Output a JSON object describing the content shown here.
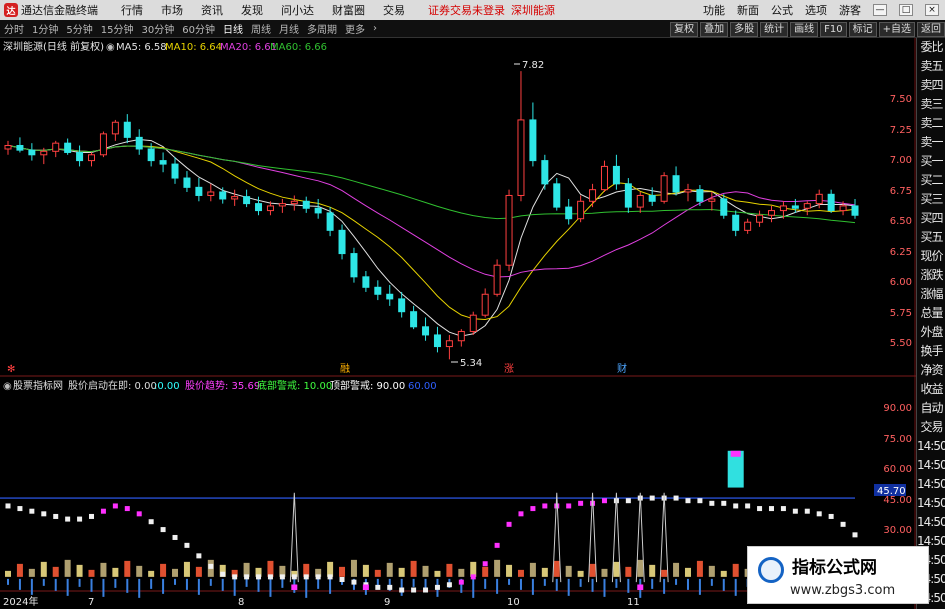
{
  "app_title": "通达信金融终端",
  "menu": [
    "行情",
    "市场",
    "资讯",
    "发现",
    "问小达",
    "财富圈",
    "交易"
  ],
  "warn_text": "证券交易未登录",
  "stock_link": "深圳能源",
  "right_menu": [
    "功能",
    "新面",
    "公式",
    "选项"
  ],
  "right_user": "游客",
  "win_buttons": [
    "—",
    "□",
    "×"
  ],
  "colors": {
    "up": "#ff4040",
    "down": "#2ee6e6",
    "ma5": "#e0e0e0",
    "ma10": "#e6d200",
    "ma20": "#e040e0",
    "ma60": "#30c030",
    "magenta": "#ff30ff",
    "yellow": "#ffff30",
    "blue_line": "#3060ff"
  },
  "period_tabs": [
    "分时",
    "1分钟",
    "5分钟",
    "15分钟",
    "30分钟",
    "60分钟",
    "日线",
    "周线",
    "月线",
    "多周期",
    "更多"
  ],
  "active_tab": "日线",
  "right_tools": [
    "复权",
    "叠加",
    "多股",
    "统计",
    "画线",
    "F10",
    "标记",
    "+自选",
    "返回"
  ],
  "main_header": {
    "title": "深圳能源(日线 前复权)",
    "ma": [
      {
        "label": "MA5: 6.58",
        "color": "#e0e0e0"
      },
      {
        "label": "MA10: 6.64",
        "color": "#e6d200"
      },
      {
        "label": "MA20: 6.61",
        "color": "#e040e0"
      },
      {
        "label": "MA60: 6.66",
        "color": "#30c030"
      }
    ]
  },
  "price_axis": [
    "7.50",
    "7.25",
    "7.00",
    "6.75",
    "6.50",
    "6.25",
    "6.00",
    "5.75",
    "5.50"
  ],
  "price_range": [
    5.3,
    7.95
  ],
  "high_label": "7.82",
  "low_label": "5.34",
  "event_marks": [
    {
      "label": "✻",
      "color": "#ff4040"
    },
    {
      "label": "融",
      "color": "#ffb000"
    },
    {
      "label": "涨",
      "color": "#ff4040"
    },
    {
      "label": "财",
      "color": "#4da6ff"
    }
  ],
  "sub_header": {
    "title": "股票指标网",
    "items": [
      {
        "label": "股价启动在即: 0.00",
        "color": "#dddddd"
      },
      {
        "label": ":0.00",
        "color": "#30ffff"
      },
      {
        "label": "股价趋势: 35.69",
        "color": "#ff40ff"
      },
      {
        "label": "底部警戒: 10.00",
        "color": "#40ff40"
      },
      {
        "label": "顶部警戒: 90.00",
        "color": "#ffffff"
      },
      {
        "label": "60.00",
        "color": "#3060ff"
      }
    ]
  },
  "sub_axis": [
    "90.00",
    "75.00",
    "60.00",
    "45.00",
    "30.00"
  ],
  "sub_current": "45.70",
  "date_axis": [
    "2024年",
    "7",
    "8",
    "9",
    "10",
    "11"
  ],
  "side_panel": [
    "委比",
    "卖五",
    "卖四",
    "卖三",
    "卖二",
    "卖一",
    "买一",
    "买二",
    "买三",
    "买四",
    "买五",
    "现价",
    "涨跌",
    "涨幅",
    "总量",
    "外盘",
    "换手",
    "净资",
    "收益",
    "自动",
    "交易",
    "14:50",
    "14:50",
    "14:50",
    "14:50",
    "14:50",
    "14:50",
    "14:50",
    "14:50",
    "14:50"
  ],
  "watermark": {
    "line1": "指标公式网",
    "line2": "www.zbgs3.com"
  },
  "chart_data": {
    "type": "candlestick",
    "series_name": "深圳能源",
    "ohlc": [
      [
        7.15,
        7.22,
        7.1,
        7.18
      ],
      [
        7.18,
        7.25,
        7.12,
        7.14
      ],
      [
        7.14,
        7.2,
        7.05,
        7.1
      ],
      [
        7.1,
        7.16,
        7.02,
        7.13
      ],
      [
        7.13,
        7.22,
        7.08,
        7.2
      ],
      [
        7.2,
        7.24,
        7.1,
        7.12
      ],
      [
        7.12,
        7.18,
        7.0,
        7.05
      ],
      [
        7.05,
        7.12,
        7.0,
        7.1
      ],
      [
        7.1,
        7.3,
        7.08,
        7.28
      ],
      [
        7.28,
        7.4,
        7.22,
        7.38
      ],
      [
        7.38,
        7.45,
        7.2,
        7.25
      ],
      [
        7.25,
        7.32,
        7.1,
        7.15
      ],
      [
        7.15,
        7.2,
        7.0,
        7.05
      ],
      [
        7.05,
        7.12,
        6.95,
        7.02
      ],
      [
        7.02,
        7.08,
        6.85,
        6.9
      ],
      [
        6.9,
        6.96,
        6.78,
        6.82
      ],
      [
        6.82,
        6.9,
        6.7,
        6.75
      ],
      [
        6.75,
        6.85,
        6.7,
        6.78
      ],
      [
        6.78,
        6.82,
        6.68,
        6.72
      ],
      [
        6.72,
        6.8,
        6.66,
        6.74
      ],
      [
        6.74,
        6.8,
        6.65,
        6.68
      ],
      [
        6.68,
        6.74,
        6.58,
        6.62
      ],
      [
        6.62,
        6.7,
        6.58,
        6.66
      ],
      [
        6.66,
        6.72,
        6.6,
        6.68
      ],
      [
        6.68,
        6.75,
        6.62,
        6.7
      ],
      [
        6.7,
        6.74,
        6.6,
        6.64
      ],
      [
        6.64,
        6.72,
        6.55,
        6.6
      ],
      [
        6.6,
        6.65,
        6.4,
        6.45
      ],
      [
        6.45,
        6.5,
        6.2,
        6.25
      ],
      [
        6.25,
        6.3,
        6.0,
        6.05
      ],
      [
        6.05,
        6.1,
        5.92,
        5.96
      ],
      [
        5.96,
        6.02,
        5.85,
        5.9
      ],
      [
        5.9,
        5.98,
        5.8,
        5.86
      ],
      [
        5.86,
        5.92,
        5.7,
        5.75
      ],
      [
        5.75,
        5.8,
        5.6,
        5.62
      ],
      [
        5.62,
        5.7,
        5.5,
        5.55
      ],
      [
        5.55,
        5.62,
        5.4,
        5.45
      ],
      [
        5.45,
        5.55,
        5.34,
        5.5
      ],
      [
        5.5,
        5.6,
        5.45,
        5.58
      ],
      [
        5.58,
        5.75,
        5.55,
        5.72
      ],
      [
        5.72,
        5.95,
        5.7,
        5.9
      ],
      [
        5.9,
        6.2,
        5.88,
        6.15
      ],
      [
        6.15,
        6.8,
        6.1,
        6.75
      ],
      [
        6.75,
        7.82,
        6.7,
        7.4
      ],
      [
        7.4,
        7.55,
        7.0,
        7.05
      ],
      [
        7.05,
        7.1,
        6.8,
        6.85
      ],
      [
        6.85,
        6.9,
        6.62,
        6.65
      ],
      [
        6.65,
        6.72,
        6.5,
        6.55
      ],
      [
        6.55,
        6.75,
        6.52,
        6.7
      ],
      [
        6.7,
        6.85,
        6.65,
        6.8
      ],
      [
        6.8,
        7.05,
        6.78,
        7.0
      ],
      [
        7.0,
        7.1,
        6.8,
        6.85
      ],
      [
        6.85,
        6.9,
        6.6,
        6.65
      ],
      [
        6.65,
        6.78,
        6.6,
        6.75
      ],
      [
        6.75,
        6.82,
        6.66,
        6.7
      ],
      [
        6.7,
        6.95,
        6.68,
        6.92
      ],
      [
        6.92,
        7.0,
        6.75,
        6.78
      ],
      [
        6.78,
        6.85,
        6.7,
        6.8
      ],
      [
        6.8,
        6.84,
        6.66,
        6.7
      ],
      [
        6.7,
        6.78,
        6.62,
        6.72
      ],
      [
        6.72,
        6.76,
        6.55,
        6.58
      ],
      [
        6.58,
        6.62,
        6.4,
        6.45
      ],
      [
        6.45,
        6.55,
        6.42,
        6.52
      ],
      [
        6.52,
        6.62,
        6.48,
        6.58
      ],
      [
        6.58,
        6.66,
        6.52,
        6.62
      ],
      [
        6.62,
        6.7,
        6.55,
        6.66
      ],
      [
        6.66,
        6.72,
        6.6,
        6.64
      ],
      [
        6.64,
        6.7,
        6.58,
        6.68
      ],
      [
        6.68,
        6.8,
        6.64,
        6.76
      ],
      [
        6.76,
        6.8,
        6.6,
        6.62
      ],
      [
        6.62,
        6.7,
        6.58,
        6.66
      ],
      [
        6.66,
        6.72,
        6.55,
        6.58
      ]
    ],
    "oscillator": {
      "range": [
        25,
        100
      ],
      "lines": [
        {
          "name": "顶部警戒",
          "value": 90
        },
        {
          "name": "",
          "value": 60
        },
        {
          "name": "底部警戒",
          "value": 10
        }
      ],
      "trend": [
        57,
        56,
        55,
        54,
        53,
        52,
        52,
        53,
        55,
        57,
        56,
        54,
        51,
        48,
        45,
        42,
        38,
        34,
        31,
        30,
        30,
        30,
        30,
        30,
        30,
        30,
        30,
        30,
        29,
        28,
        27,
        26,
        26,
        25,
        25,
        25,
        26,
        27,
        28,
        30,
        35,
        42,
        50,
        54,
        56,
        57,
        57,
        57,
        58,
        58,
        59,
        59,
        59,
        60,
        60,
        60,
        60,
        59,
        59,
        58,
        58,
        57,
        57,
        56,
        56,
        56,
        55,
        55,
        54,
        53,
        50,
        46
      ]
    }
  }
}
